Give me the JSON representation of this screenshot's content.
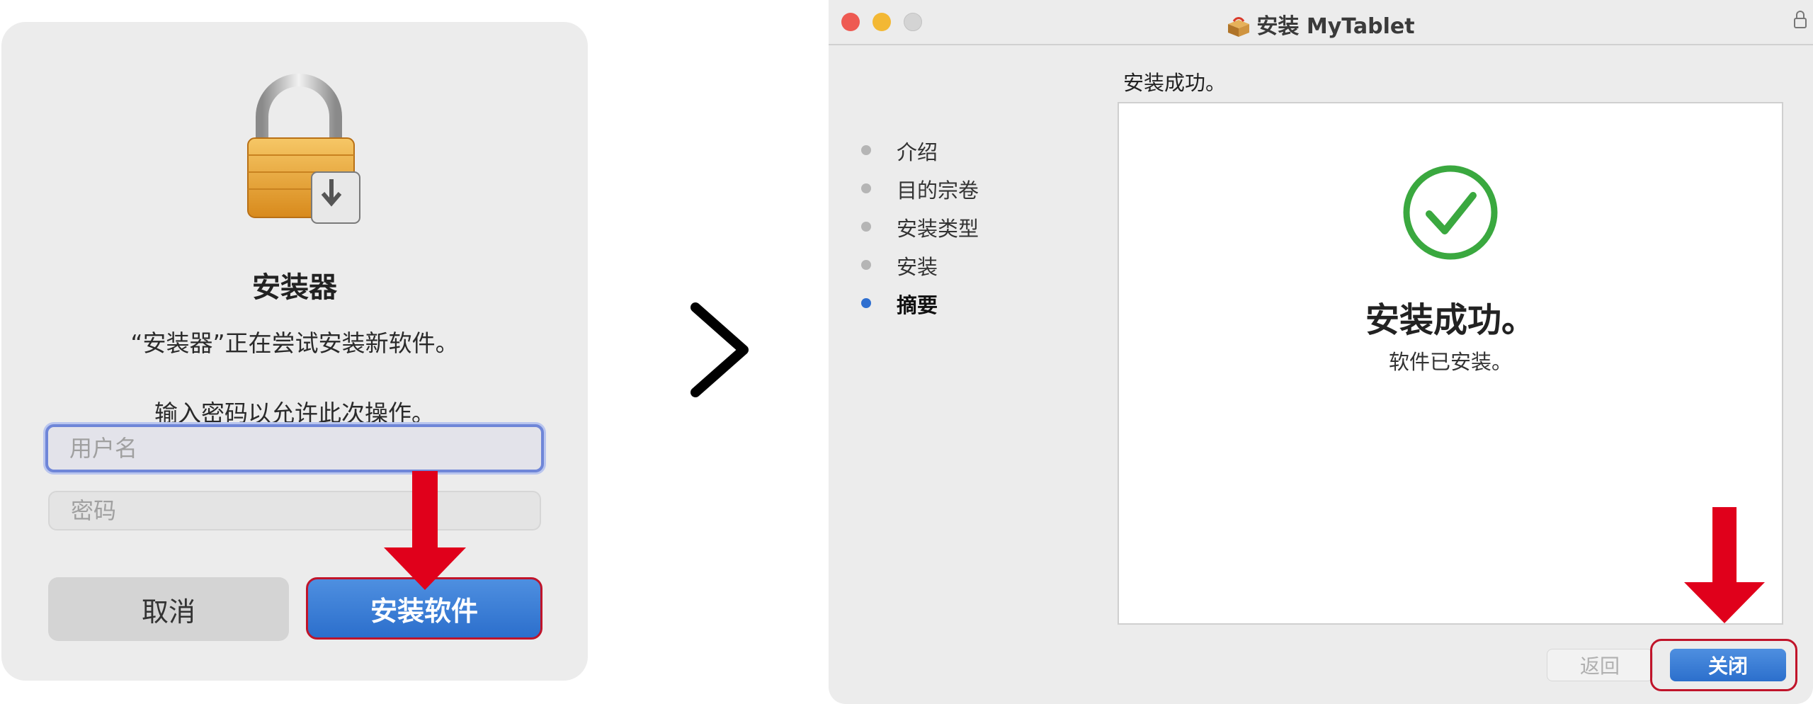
{
  "auth_dialog": {
    "title": "安装器",
    "message": "“安装器”正在尝试安装新软件。",
    "prompt": "输入密码以允许此次操作。",
    "username_placeholder": "用户名",
    "password_placeholder": "密码",
    "cancel_label": "取消",
    "install_label": "安装软件"
  },
  "installer": {
    "window_title": "安装 MyTablet",
    "page_heading": "安装成功。",
    "steps": [
      {
        "label": "介绍",
        "active": false
      },
      {
        "label": "目的宗卷",
        "active": false
      },
      {
        "label": "安装类型",
        "active": false
      },
      {
        "label": "安装",
        "active": false
      },
      {
        "label": "摘要",
        "active": true
      }
    ],
    "success_title": "安装成功。",
    "success_subtitle": "软件已安装。",
    "back_label": "返回",
    "close_label": "关闭"
  },
  "icons": {
    "lock": "lock-icon",
    "chevron": "chevron-right-icon",
    "check": "checkmark-circle-icon",
    "package": "package-icon",
    "arrow": "arrow-down-icon"
  },
  "colors": {
    "accent_blue": "#2c6fcc",
    "highlight_red": "#c0142a",
    "arrow_red": "#e0001b",
    "success_green": "#3aa83f"
  }
}
